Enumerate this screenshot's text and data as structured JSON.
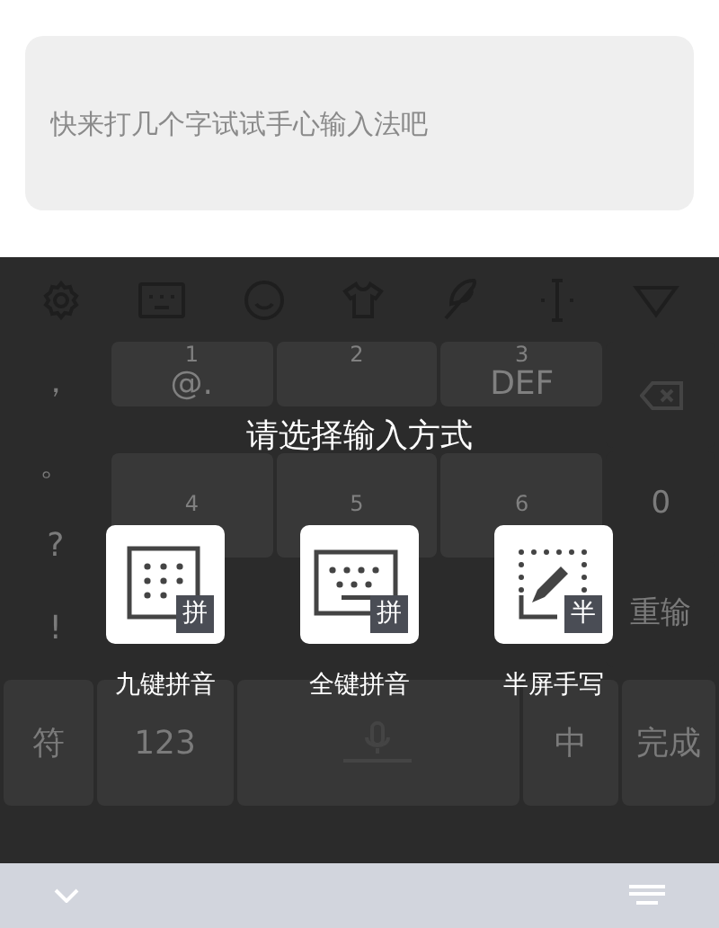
{
  "input": {
    "placeholder": "快来打几个字试试手心输入法吧"
  },
  "keyboard": {
    "punctuation": [
      "，",
      "。",
      "?",
      "!"
    ],
    "keys": [
      {
        "number": "1",
        "letters": "@."
      },
      {
        "number": "2"
      },
      {
        "number": "3",
        "letters": "DEF"
      },
      {
        "number": "4"
      },
      {
        "number": "5"
      },
      {
        "number": "6"
      }
    ],
    "side_keys": [
      {
        "kind": "backspace"
      },
      {
        "kind": "text",
        "label": "0"
      },
      {
        "kind": "text",
        "label": "重输"
      }
    ],
    "bottom_row": [
      {
        "kind": "text",
        "label": "符"
      },
      {
        "kind": "text",
        "label": "123"
      },
      {
        "kind": "space"
      },
      {
        "kind": "text",
        "label": "中"
      },
      {
        "kind": "text",
        "label": "完成"
      }
    ]
  },
  "dialog": {
    "title": "请选择输入方式",
    "options": [
      {
        "kind": "nine_key",
        "label": "九键拼音",
        "badge": "拼"
      },
      {
        "kind": "full_key",
        "label": "全键拼音",
        "badge": "拼"
      },
      {
        "kind": "handwriting",
        "label": "半屏手写",
        "badge": "半"
      }
    ]
  }
}
